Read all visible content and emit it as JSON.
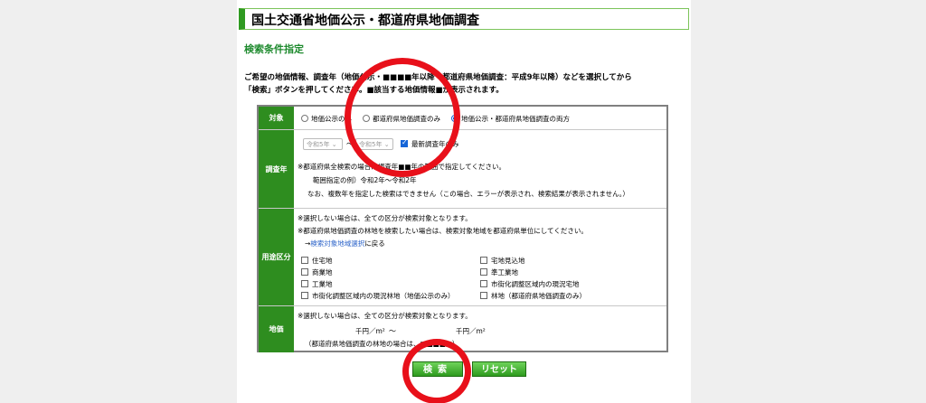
{
  "header": {
    "title": "国土交通省地価公示・都道府県地価調査"
  },
  "section_title": "検索条件指定",
  "intro": {
    "line1": "ご希望の地価情報、調査年（地価公示・■■■■年以降　都道府県地価調査：平成9年以降）などを選択してから",
    "line2": "「検索」ボタンを押してください。■該当する地価情報■が表示されます。"
  },
  "target": {
    "label": "対象",
    "options": [
      "地価公示のみ",
      "都道府県地価調査のみ",
      "地価公示・都道府県地価調査の両方"
    ],
    "selected": "地価公示・都道府県地価調査の両方"
  },
  "year": {
    "label": "調査年",
    "from": "令和5年",
    "separator": "〜",
    "to": "令和5年",
    "latest_only": "最新調査年のみ",
    "note1": "※都道府県全検索の場合は調査年■■年の範囲で指定してください。",
    "note2": "範囲指定の例）令和2年〜令和2年",
    "note3": "なお、複数年を指定した検索はできません（この場合、エラーが表示され、検索結果が表示されません。）"
  },
  "use": {
    "label": "用途区分",
    "note1": "※選択しない場合は、全ての区分が検索対象となります。",
    "note2": "※都道府県地価調査の林地を検索したい場合は、検索対象地域を都道府県単位にしてください。",
    "link_prefix": "→",
    "link": "検索対象地域選択",
    "link_suffix": "に戻る",
    "left": [
      "住宅地",
      "商業地",
      "工業地",
      "市街化調整区域内の現況林地（地価公示のみ）"
    ],
    "right": [
      "宅地見込地",
      "準工業地",
      "市街化調整区域内の現況宅地",
      "林地（都道府県地価調査のみ）"
    ]
  },
  "price": {
    "label": "地価",
    "note": "※選択しない場合は、全ての区分が検索対象となります。",
    "unit1": "千円／m²",
    "separator": "〜",
    "unit2": "千円／m²",
    "note2": "（都道府県地価調査の林地の場合は、■■■■■）"
  },
  "buttons": {
    "search": "検索",
    "reset": "リセット"
  },
  "colors": {
    "green": "#2e8d1f",
    "link": "#2a62c9",
    "mark": "#e8101a"
  }
}
